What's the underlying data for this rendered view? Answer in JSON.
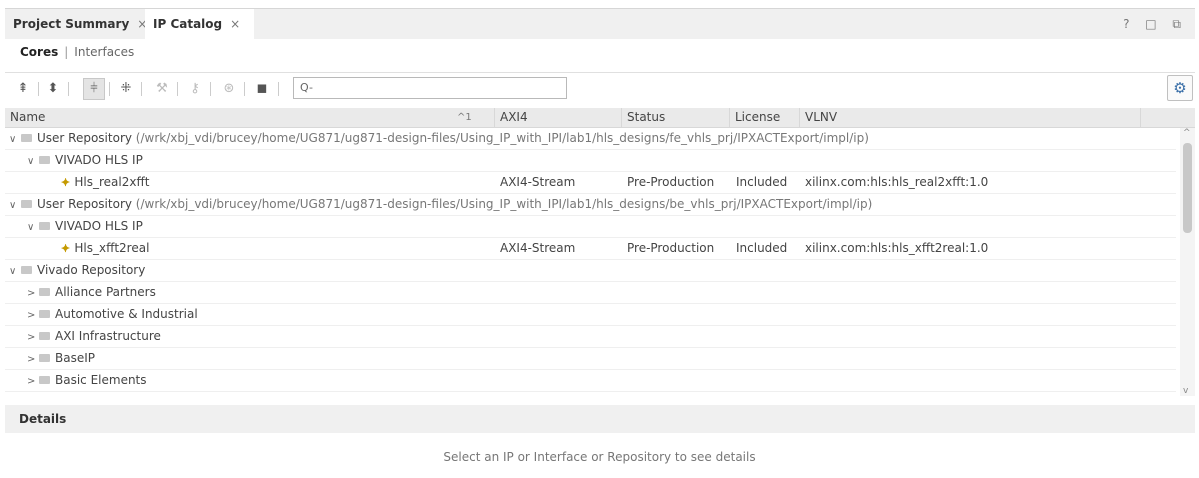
{
  "tabs": [
    {
      "label": "Project Summary",
      "close": "×"
    },
    {
      "label": "IP Catalog",
      "close": "×"
    }
  ],
  "window_controls": "? □ ⧉",
  "subtabs": {
    "cores": "Cores",
    "separator": "|",
    "interfaces": "Interfaces"
  },
  "toolbar": {
    "search_placeholder": "Q-"
  },
  "columns": {
    "name": "Name",
    "sort_indicator": "^1",
    "axi4": "AXI4",
    "status": "Status",
    "license": "License",
    "vlnv": "VLNV"
  },
  "rows": [
    {
      "label": "User Repository",
      "path": " (/wrk/xbj_vdi/brucey/home/UG871/ug871-design-files/Using_IP_with_IPI/lab1/hls_designs/fe_vhls_prj/IPXACTExport/impl/ip)"
    },
    {
      "label": "VIVADO HLS IP"
    },
    {
      "label": "Hls_real2xfft",
      "axi4": "AXI4-Stream",
      "status": "Pre-Production",
      "license": "Included",
      "vlnv": "xilinx.com:hls:hls_real2xfft:1.0"
    },
    {
      "label": "User Repository",
      "path": " (/wrk/xbj_vdi/brucey/home/UG871/ug871-design-files/Using_IP_with_IPI/lab1/hls_designs/be_vhls_prj/IPXACTExport/impl/ip)"
    },
    {
      "label": "VIVADO HLS IP"
    },
    {
      "label": "Hls_xfft2real",
      "axi4": "AXI4-Stream",
      "status": "Pre-Production",
      "license": "Included",
      "vlnv": "xilinx.com:hls:hls_xfft2real:1.0"
    },
    {
      "label": "Vivado Repository"
    },
    {
      "label": "Alliance Partners"
    },
    {
      "label": "Automotive & Industrial"
    },
    {
      "label": "AXI Infrastructure"
    },
    {
      "label": "BaseIP"
    },
    {
      "label": "Basic Elements"
    }
  ],
  "details": {
    "title": "Details",
    "message": "Select an IP or Interface or Repository to see details"
  }
}
